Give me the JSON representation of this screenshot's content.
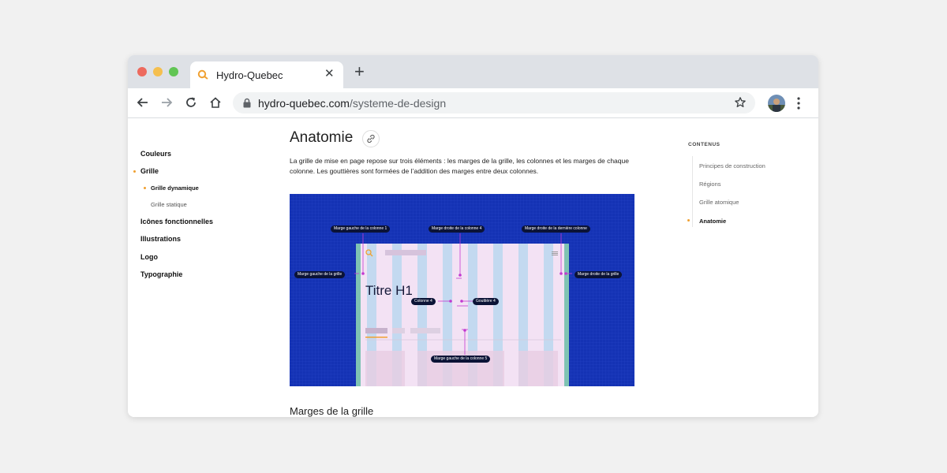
{
  "browser": {
    "tab_title": "Hydro-Quebec",
    "close_label": "✕",
    "new_tab_label": "+",
    "url_host": "hydro-quebec.com",
    "url_path": "/systeme-de-design",
    "traffic_colors": [
      "#ed6a5e",
      "#f5bf4f",
      "#61c554"
    ],
    "brand_color": "#f0a030"
  },
  "sidebar": {
    "items": [
      "Couleurs",
      "Grille",
      "Icônes fonctionnelles",
      "Illustrations",
      "Logo",
      "Typographie"
    ],
    "sub_items": [
      "Grille dynamique",
      "Grille statique"
    ]
  },
  "main": {
    "title": "Anatomie",
    "description": "La grille de mise en page repose sur trois éléments : les marges de la grille, les colonnes et les marges de chaque colonne. Les gouttières sont formées de l’addition des marges entre deux colonnes.",
    "next_heading": "Marges de la grille"
  },
  "figure": {
    "labels": {
      "col1_left": "Marge gauche de la colonne 1",
      "col4_right": "Marge droite de la colonne 4",
      "last_right": "Marge droite de la dernière colonne",
      "grid_left": "Marge gauche de la grille",
      "grid_right": "Marge droite de la grille",
      "column4": "Colonne 4",
      "gutter4": "Gouttière 4",
      "col5_left": "Marge gauche de la colonne 5"
    },
    "heading": "Titre H1"
  },
  "toc": {
    "heading": "CONTENUS",
    "items": [
      "Principes de construction",
      "Régions",
      "Grille atomique",
      "Anatomie"
    ]
  }
}
